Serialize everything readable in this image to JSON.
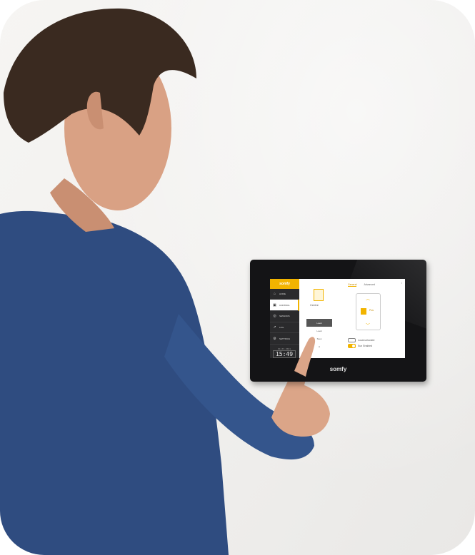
{
  "tablet": {
    "brand": "somfy",
    "screen": {
      "logo": "somfy",
      "nav": [
        {
          "label": "HOME",
          "icon": "home-icon"
        },
        {
          "label": "CONTROL",
          "icon": "device-icon",
          "active": true
        },
        {
          "label": "SENSORS",
          "icon": "sensor-icon"
        },
        {
          "label": "LOG",
          "icon": "chart-icon"
        },
        {
          "label": "SETTINGS",
          "icon": "gear-icon"
        }
      ],
      "clock": {
        "date": "04.03.2021",
        "time": "15:49"
      },
      "device_label": "Centre",
      "list": [
        "Level",
        "Level",
        "Scen",
        "A"
      ],
      "tabs": {
        "general": "General",
        "advanced": "Advanced"
      },
      "info": "i",
      "level": "Pos",
      "toggles": [
        {
          "label": "Local unlocked",
          "on": false
        },
        {
          "label": "Sun Enabled",
          "on": true
        }
      ]
    }
  },
  "colors": {
    "accent": "#f2b400",
    "shirt": "#2e4d82",
    "skin": "#d9a184",
    "hair": "#3a2a20"
  }
}
